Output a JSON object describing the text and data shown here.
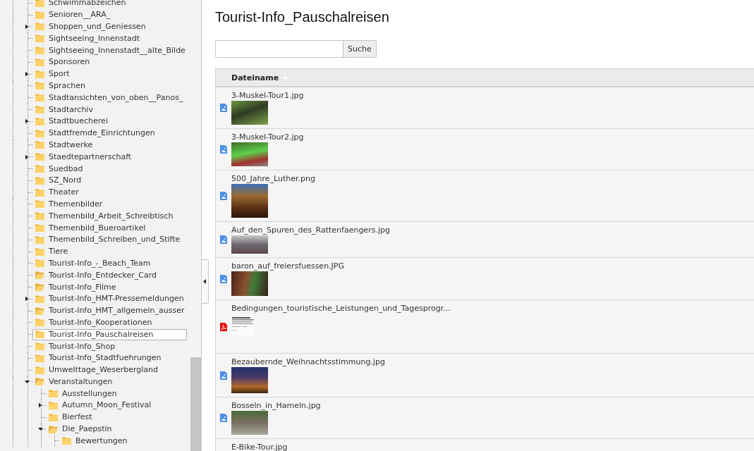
{
  "sidebar": {
    "tree": [
      {
        "label": "Schwimmabzeichen",
        "kind": "folder",
        "selected": false
      },
      {
        "label": "Senioren__ARA_",
        "kind": "folder",
        "selected": false
      },
      {
        "label": "Shoppen_und_Geniessen",
        "kind": "folder",
        "selected": false,
        "expanded": false
      },
      {
        "label": "Sightseeing_Innenstadt",
        "kind": "folder",
        "selected": false
      },
      {
        "label": "Sightseeing_Innenstadt__alte_Bilde",
        "kind": "folder",
        "selected": false
      },
      {
        "label": "Sponsoren",
        "kind": "folder",
        "selected": false
      },
      {
        "label": "Sport",
        "kind": "folder",
        "selected": false,
        "expanded": false
      },
      {
        "label": "Sprachen",
        "kind": "folder",
        "selected": false
      },
      {
        "label": "Stadtansichten_von_oben__Panos_",
        "kind": "folder",
        "selected": false
      },
      {
        "label": "Stadtarchiv",
        "kind": "folder",
        "selected": false
      },
      {
        "label": "Stadtbuecherei",
        "kind": "folder",
        "selected": false,
        "expanded": false
      },
      {
        "label": "Stadtfremde_Einrichtungen",
        "kind": "folder",
        "selected": false
      },
      {
        "label": "Stadtwerke",
        "kind": "folder",
        "selected": false
      },
      {
        "label": "Staedtepartnerschaft",
        "kind": "folder",
        "selected": false,
        "expanded": false
      },
      {
        "label": "Suedbad",
        "kind": "folder",
        "selected": false
      },
      {
        "label": "SZ_Nord",
        "kind": "folder",
        "selected": false
      },
      {
        "label": "Theater",
        "kind": "folder",
        "selected": false
      },
      {
        "label": "Themenbilder",
        "kind": "folder",
        "selected": false
      },
      {
        "label": "Themenbild_Arbeit_Schreibtisch",
        "kind": "folder",
        "selected": false
      },
      {
        "label": "Themenbild_Bueroartikel",
        "kind": "folder",
        "selected": false
      },
      {
        "label": "Themenbild_Schreiben_und_Stifte",
        "kind": "folder",
        "selected": false
      },
      {
        "label": "Tiere",
        "kind": "folder",
        "selected": false
      },
      {
        "label": "Tourist-Info_-_Beach_Team",
        "kind": "folder",
        "selected": false
      },
      {
        "label": "Tourist-Info_Entdecker_Card",
        "kind": "open_folder",
        "selected": false
      },
      {
        "label": "Tourist-Info_Filme",
        "kind": "open_folder",
        "selected": false
      },
      {
        "label": "Tourist-Info_HMT-Pressemeldungen",
        "kind": "folder",
        "selected": false,
        "expanded": false
      },
      {
        "label": "Tourist-Info_HMT_allgemein_ausser",
        "kind": "open_folder",
        "selected": false
      },
      {
        "label": "Tourist-Info_Kooperationen",
        "kind": "folder",
        "selected": false
      },
      {
        "label": "Tourist-Info_Pauschalreisen",
        "kind": "folder",
        "selected": true
      },
      {
        "label": "Tourist-Info_Shop",
        "kind": "folder",
        "selected": false
      },
      {
        "label": "Tourist-Info_Stadtfuehrungen",
        "kind": "folder",
        "selected": false
      },
      {
        "label": "Umwelttage_Weserbergland",
        "kind": "folder",
        "selected": false
      },
      {
        "label": "Veranstaltungen",
        "kind": "open_folder",
        "selected": false,
        "expanded": true,
        "children": [
          {
            "label": "Ausstellungen",
            "kind": "folder",
            "selected": false
          },
          {
            "label": "Autumn_Moon_Festival",
            "kind": "folder",
            "selected": false,
            "expanded": false
          },
          {
            "label": "Bierfest",
            "kind": "folder",
            "selected": false
          },
          {
            "label": "Die_Paepstin",
            "kind": "open_folder",
            "selected": false,
            "expanded": true,
            "children": [
              {
                "label": "Bewertungen",
                "kind": "folder",
                "selected": false
              }
            ]
          }
        ]
      }
    ]
  },
  "main": {
    "title": "Tourist-Info_Pauschalreisen",
    "search": {
      "button": "Suche"
    },
    "table": {
      "columns": [
        {
          "label": "Dateiname",
          "sorted_ascending": true
        }
      ],
      "rows": [
        {
          "name": "3-Muskel-Tour1.jpg",
          "kind": "image"
        },
        {
          "name": "3-Muskel-Tour2.jpg",
          "kind": "image"
        },
        {
          "name": "500_Jahre_Luther.png",
          "kind": "image"
        },
        {
          "name": "Auf_den_Spuren_des_Rattenfaengers.jpg",
          "kind": "image"
        },
        {
          "name": "baron_auf_freiersfuessen.JPG",
          "kind": "image"
        },
        {
          "name": "Bedingungen_touristische_Leistungen_und_Tagesprogr...",
          "kind": "pdf"
        },
        {
          "name": "Bezaubernde_Weihnachtsstimmung.jpg",
          "kind": "image"
        },
        {
          "name": "Bosseln_in_Hameln.jpg",
          "kind": "image"
        },
        {
          "name": "E-Bike-Tour.jpg"
        }
      ]
    }
  }
}
